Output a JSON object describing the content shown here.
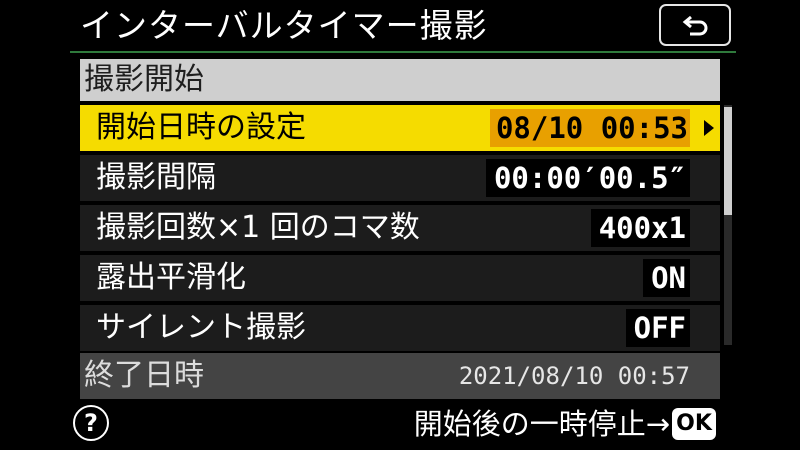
{
  "header": {
    "title": "インターバルタイマー撮影",
    "back_icon": "return-icon",
    "rule_color": "#2f7a3c"
  },
  "section": {
    "label": "撮影開始"
  },
  "menu": {
    "items": [
      {
        "label": "開始日時の設定",
        "value": "08/10 00:53",
        "selected": true
      },
      {
        "label": "撮影間隔",
        "value": "00:00′00.5″",
        "selected": false
      },
      {
        "label": "撮影回数×1 回のコマ数",
        "value": "400x1",
        "selected": false
      },
      {
        "label": "露出平滑化",
        "value": "ON",
        "selected": false
      },
      {
        "label": "サイレント撮影",
        "value": "OFF",
        "selected": false
      }
    ],
    "selected_color": "#f5dc00",
    "selected_value_color": "#e8a000"
  },
  "end_time": {
    "label": "終了日時",
    "value": "2021/08/10 00:57"
  },
  "footer": {
    "help_icon_text": "?",
    "hint_text": "開始後の一時停止→",
    "ok_label": "OK"
  }
}
